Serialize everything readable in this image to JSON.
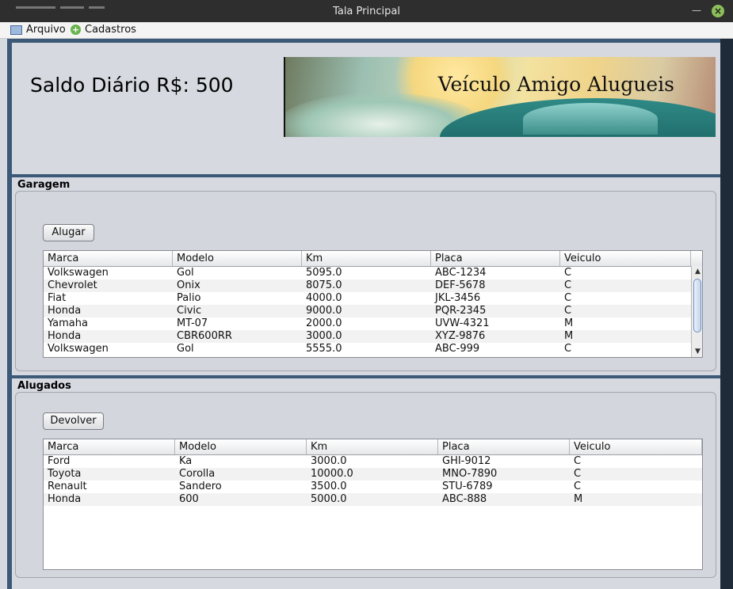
{
  "window": {
    "title": "Tala Principal"
  },
  "menu": {
    "arquivo": "Arquivo",
    "cadastros": "Cadastros"
  },
  "header": {
    "saldo": "Saldo Diário R$: 500",
    "banner_text": "Veículo Amigo Alugueis"
  },
  "garagem": {
    "title": "Garagem",
    "button": "Alugar",
    "columns": [
      "Marca",
      "Modelo",
      "Km",
      "Placa",
      "Veiculo"
    ],
    "rows": [
      [
        "Volkswagen",
        "Gol",
        "5095.0",
        "ABC-1234",
        "C"
      ],
      [
        "Chevrolet",
        "Onix",
        "8075.0",
        "DEF-5678",
        "C"
      ],
      [
        "Fiat",
        "Palio",
        "4000.0",
        "JKL-3456",
        "C"
      ],
      [
        "Honda",
        "Civic",
        "9000.0",
        "PQR-2345",
        "C"
      ],
      [
        "Yamaha",
        "MT-07",
        "2000.0",
        "UVW-4321",
        "M"
      ],
      [
        "Honda",
        "CBR600RR",
        "3000.0",
        "XYZ-9876",
        "M"
      ],
      [
        "Volkswagen",
        "Gol",
        "5555.0",
        "ABC-999",
        "C"
      ]
    ]
  },
  "alugados": {
    "title": "Alugados",
    "button": "Devolver",
    "columns": [
      "Marca",
      "Modelo",
      "Km",
      "Placa",
      "Veiculo"
    ],
    "rows": [
      [
        "Ford",
        "Ka",
        "3000.0",
        "GHI-9012",
        "C"
      ],
      [
        "Toyota",
        "Corolla",
        "10000.0",
        "MNO-7890",
        "C"
      ],
      [
        "Renault",
        "Sandero",
        "3500.0",
        "STU-6789",
        "C"
      ],
      [
        "Honda",
        "600",
        "5000.0",
        "ABC-888",
        "M"
      ]
    ]
  }
}
